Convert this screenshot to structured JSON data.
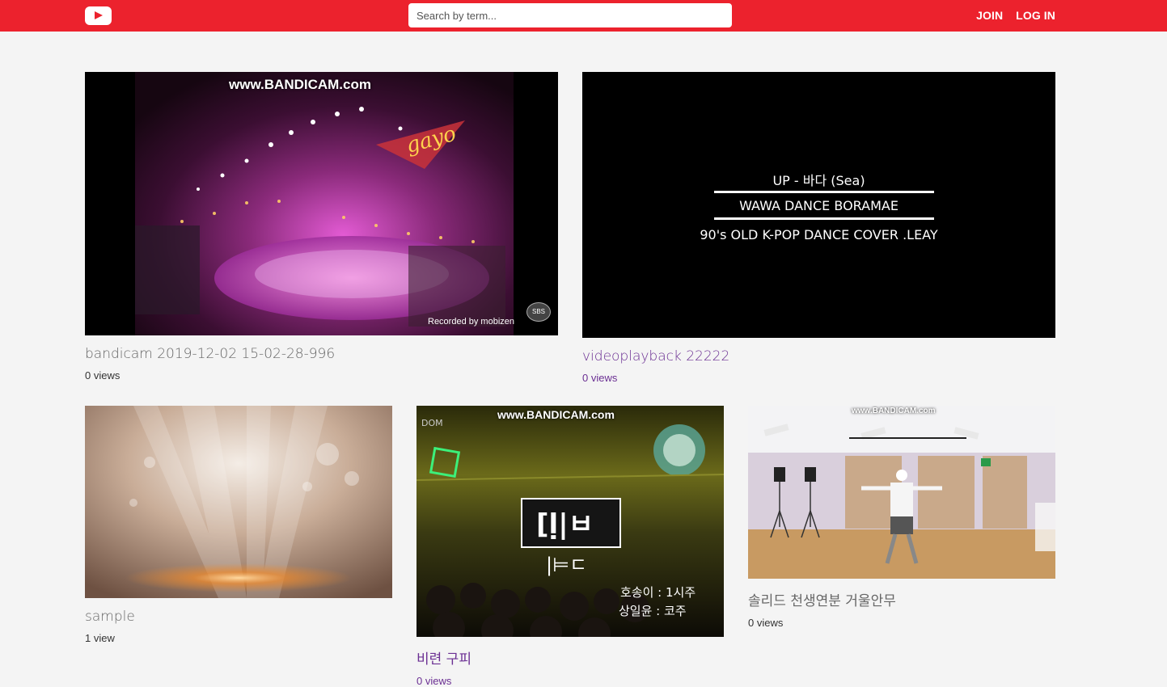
{
  "header": {
    "logo_icon": "youtube-play-icon",
    "brand_color": "#ec222d",
    "search": {
      "placeholder": "Search by term...",
      "value": ""
    },
    "nav": {
      "join": "JOIN",
      "login": "LOG IN"
    }
  },
  "videos": [
    {
      "title": "bandicam 2019-12-02 15-02-28-996",
      "views": "0 views",
      "watermark": "www.BANDICAM.com",
      "recorded_by": "Recorded by mobizen",
      "badge": "SBS"
    },
    {
      "title": "videoplayback 22222",
      "views": "0 views",
      "overlay": [
        "UP - 바다 (Sea)",
        "WAWA DANCE BORAMAE",
        "90's OLD K-POP DANCE COVER .LEAY"
      ]
    },
    {
      "title": "sample",
      "views": "1 view"
    },
    {
      "title": "비련 구피",
      "views": "0 views",
      "watermark": "www.BANDICAM.com"
    },
    {
      "title": "솔리드 천생연분 거울안무",
      "views": "0 views",
      "watermark": "www.BANDICAM.com"
    }
  ],
  "colors": {
    "page_bg": "#f4f4f4",
    "visited_link": "#6b2f93"
  }
}
